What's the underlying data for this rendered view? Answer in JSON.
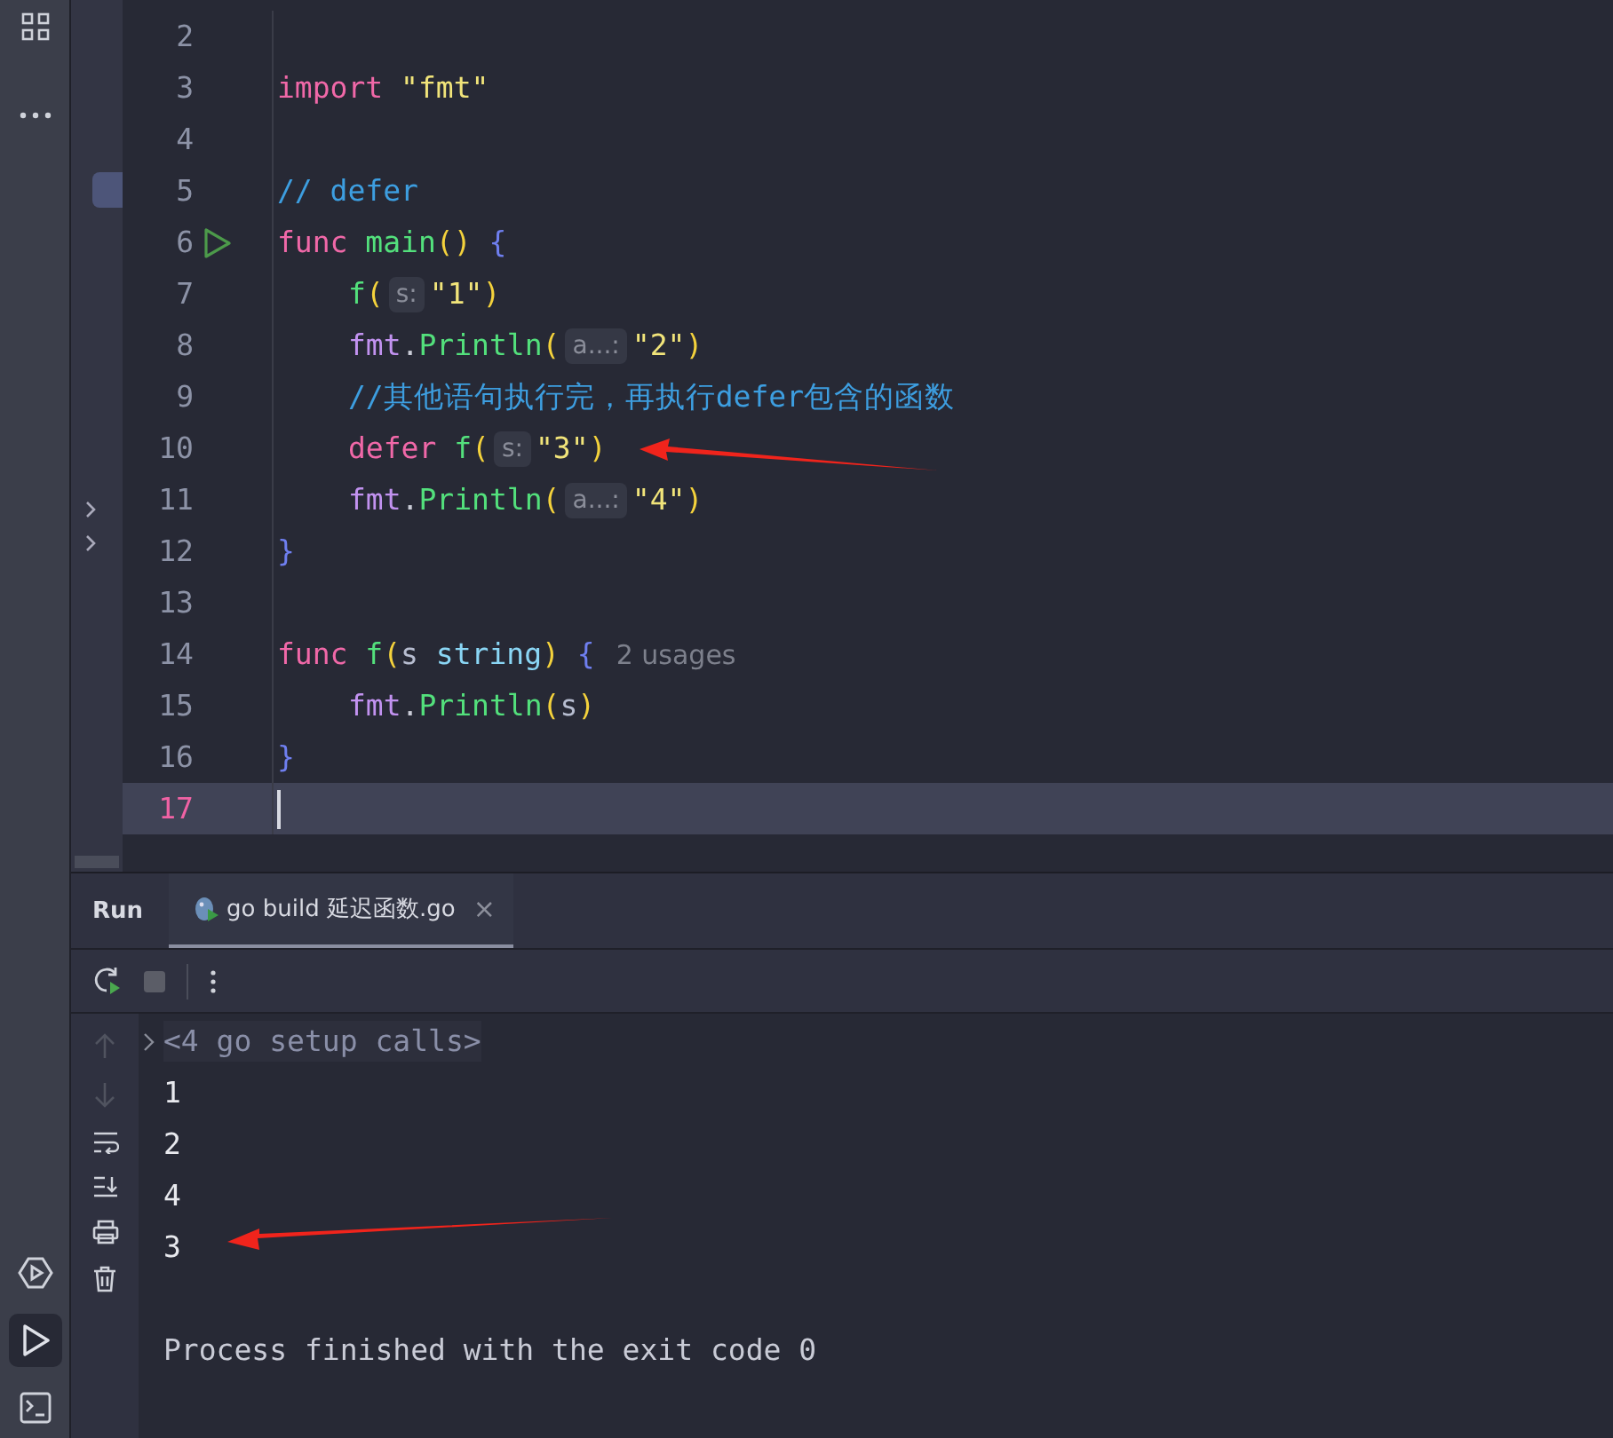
{
  "side_toolbar": {
    "top": [
      {
        "kind": "grid",
        "selected": false
      },
      {
        "kind": "more",
        "selected": false
      }
    ],
    "bottom": [
      {
        "kind": "services",
        "selected": false
      },
      {
        "kind": "run",
        "selected": true
      },
      {
        "kind": "terminal",
        "selected": false
      }
    ]
  },
  "editor": {
    "lines": [
      {
        "number": "2"
      },
      {
        "number": "3",
        "tokens": [
          {
            "text": "import ",
            "kind": "keyword"
          },
          {
            "text": "\"fmt\"",
            "kind": "string"
          }
        ]
      },
      {
        "number": "4"
      },
      {
        "number": "5",
        "tokens": [
          {
            "text": "// defer",
            "kind": "comment"
          }
        ]
      },
      {
        "number": "6",
        "run_marker": true,
        "tokens": [
          {
            "text": "func ",
            "kind": "keyword"
          },
          {
            "text": "main",
            "kind": "function"
          },
          {
            "text": "() ",
            "kind": "paren"
          },
          {
            "text": "{",
            "kind": "brace"
          }
        ]
      },
      {
        "number": "7",
        "indented": true,
        "tokens": [
          {
            "text": "f",
            "kind": "function"
          },
          {
            "text": "(",
            "kind": "paren"
          },
          {
            "text": "s:",
            "kind": "hint"
          },
          {
            "text": "\"1\"",
            "kind": "string"
          },
          {
            "text": ")",
            "kind": "paren"
          }
        ]
      },
      {
        "number": "8",
        "indented": true,
        "tokens": [
          {
            "text": "fmt",
            "kind": "package"
          },
          {
            "text": ".",
            "kind": "plain"
          },
          {
            "text": "Println",
            "kind": "function"
          },
          {
            "text": "(",
            "kind": "paren"
          },
          {
            "text": "a...:",
            "kind": "hint"
          },
          {
            "text": "\"2\"",
            "kind": "string"
          },
          {
            "text": ")",
            "kind": "paren"
          }
        ]
      },
      {
        "number": "9",
        "indented": true,
        "tokens": [
          {
            "text": "//其他语句执行完，再执行defer包含的函数",
            "kind": "comment"
          }
        ]
      },
      {
        "number": "10",
        "indented": true,
        "tokens": [
          {
            "text": "defer ",
            "kind": "keyword"
          },
          {
            "text": "f",
            "kind": "function"
          },
          {
            "text": "(",
            "kind": "paren"
          },
          {
            "text": "s:",
            "kind": "hint"
          },
          {
            "text": "\"3\"",
            "kind": "string"
          },
          {
            "text": ")",
            "kind": "paren"
          }
        ]
      },
      {
        "number": "11",
        "indented": true,
        "tokens": [
          {
            "text": "fmt",
            "kind": "package"
          },
          {
            "text": ".",
            "kind": "plain"
          },
          {
            "text": "Println",
            "kind": "function"
          },
          {
            "text": "(",
            "kind": "paren"
          },
          {
            "text": "a...:",
            "kind": "hint"
          },
          {
            "text": "\"4\"",
            "kind": "string"
          },
          {
            "text": ")",
            "kind": "paren"
          }
        ]
      },
      {
        "number": "12",
        "tokens": [
          {
            "text": "}",
            "kind": "brace"
          }
        ]
      },
      {
        "number": "13"
      },
      {
        "number": "14",
        "tokens": [
          {
            "text": "func ",
            "kind": "keyword"
          },
          {
            "text": "f",
            "kind": "function"
          },
          {
            "text": "(",
            "kind": "paren"
          },
          {
            "text": "s ",
            "kind": "param"
          },
          {
            "text": "string",
            "kind": "type"
          },
          {
            "text": ") ",
            "kind": "paren"
          },
          {
            "text": "{",
            "kind": "brace"
          },
          {
            "text": "2 usages",
            "kind": "usage"
          }
        ]
      },
      {
        "number": "15",
        "indented": true,
        "tokens": [
          {
            "text": "fmt",
            "kind": "package"
          },
          {
            "text": ".",
            "kind": "plain"
          },
          {
            "text": "Println",
            "kind": "function"
          },
          {
            "text": "(",
            "kind": "paren"
          },
          {
            "text": "s",
            "kind": "param"
          },
          {
            "text": ")",
            "kind": "paren"
          }
        ]
      },
      {
        "number": "16",
        "tokens": [
          {
            "text": "}",
            "kind": "brace"
          }
        ]
      },
      {
        "number": "17",
        "current": true
      }
    ]
  },
  "run_panel": {
    "title": "Run",
    "tabs": [
      {
        "label": "go build 延迟函数.go",
        "selected": true,
        "close": "×"
      }
    ],
    "output": [
      {
        "text": "<4 go setup calls>",
        "kind": "fold"
      },
      {
        "text": "1",
        "kind": "line"
      },
      {
        "text": "2",
        "kind": "line"
      },
      {
        "text": "4",
        "kind": "line"
      },
      {
        "text": "3",
        "kind": "line"
      },
      {
        "text": "Process finished with the exit code 0",
        "kind": "status"
      }
    ]
  }
}
